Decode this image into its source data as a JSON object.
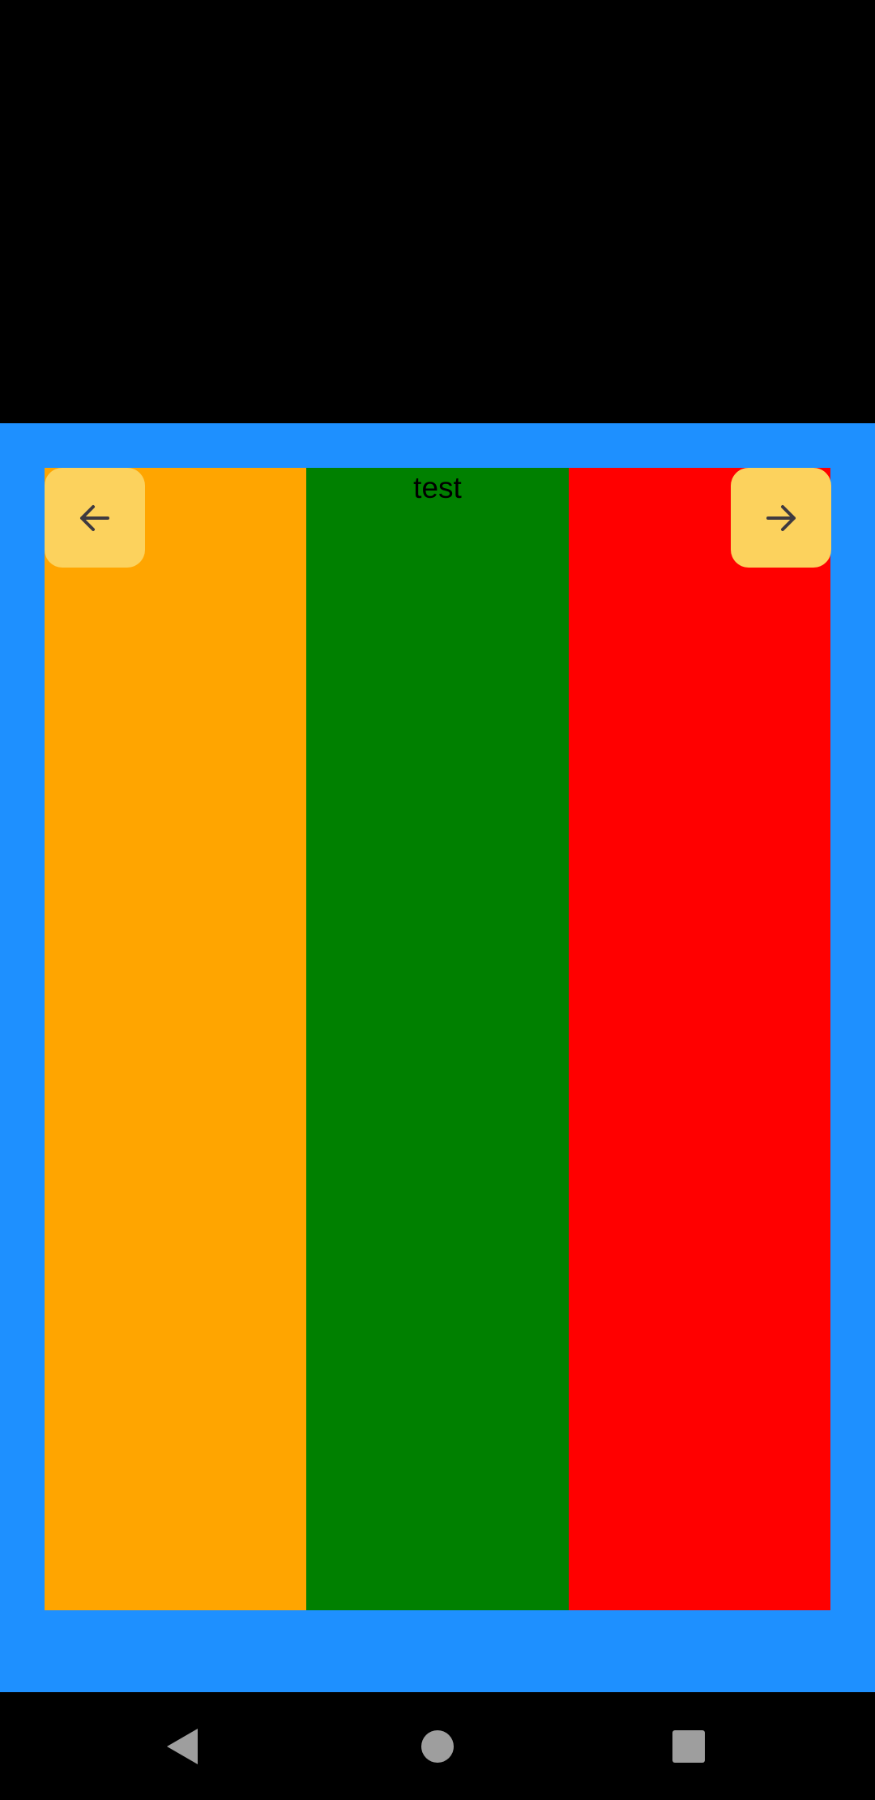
{
  "carousel": {
    "panels": [
      {
        "color": "#FFA500",
        "text": ""
      },
      {
        "color": "#008000",
        "text": "test"
      },
      {
        "color": "#FF0000",
        "text": ""
      }
    ],
    "prev_button": {
      "icon": "arrow-left-icon"
    },
    "next_button": {
      "icon": "arrow-right-icon"
    }
  },
  "colors": {
    "background_blue": "#1E90FF",
    "button_yellow": "#FCD25D",
    "icon_dark": "#3F3A40",
    "system_bar": "#000000",
    "system_icon": "#9E9E9E"
  },
  "system_nav": {
    "back": "back-triangle-icon",
    "home": "home-circle-icon",
    "recents": "recents-square-icon"
  }
}
